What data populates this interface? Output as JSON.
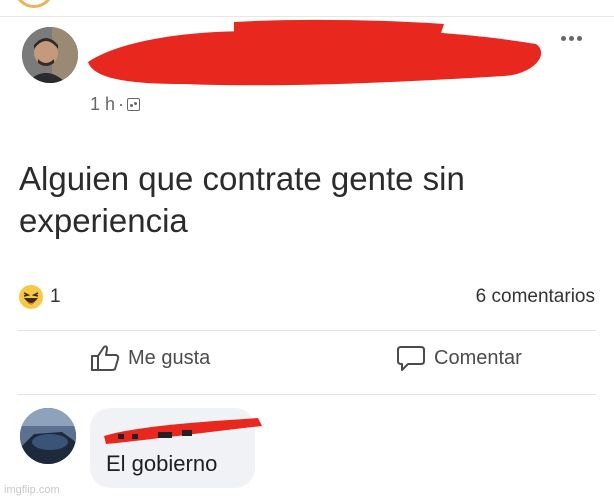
{
  "post": {
    "time": "1 h",
    "separator": "·",
    "privacy_icon": "friends-privacy-icon",
    "text": "Alguien que contrate gente sin experiencia"
  },
  "stats": {
    "reaction_icon": "haha-icon",
    "reaction_count": "1",
    "comments_label": "6 comentarios"
  },
  "actions": {
    "like_label": "Me gusta",
    "comment_label": "Comentar"
  },
  "comment": {
    "text": "El gobierno"
  },
  "watermark": "imgflip.com",
  "colors": {
    "redaction": "#e8281e",
    "secondary_text": "#65676b",
    "bubble": "#f0f2f5"
  }
}
